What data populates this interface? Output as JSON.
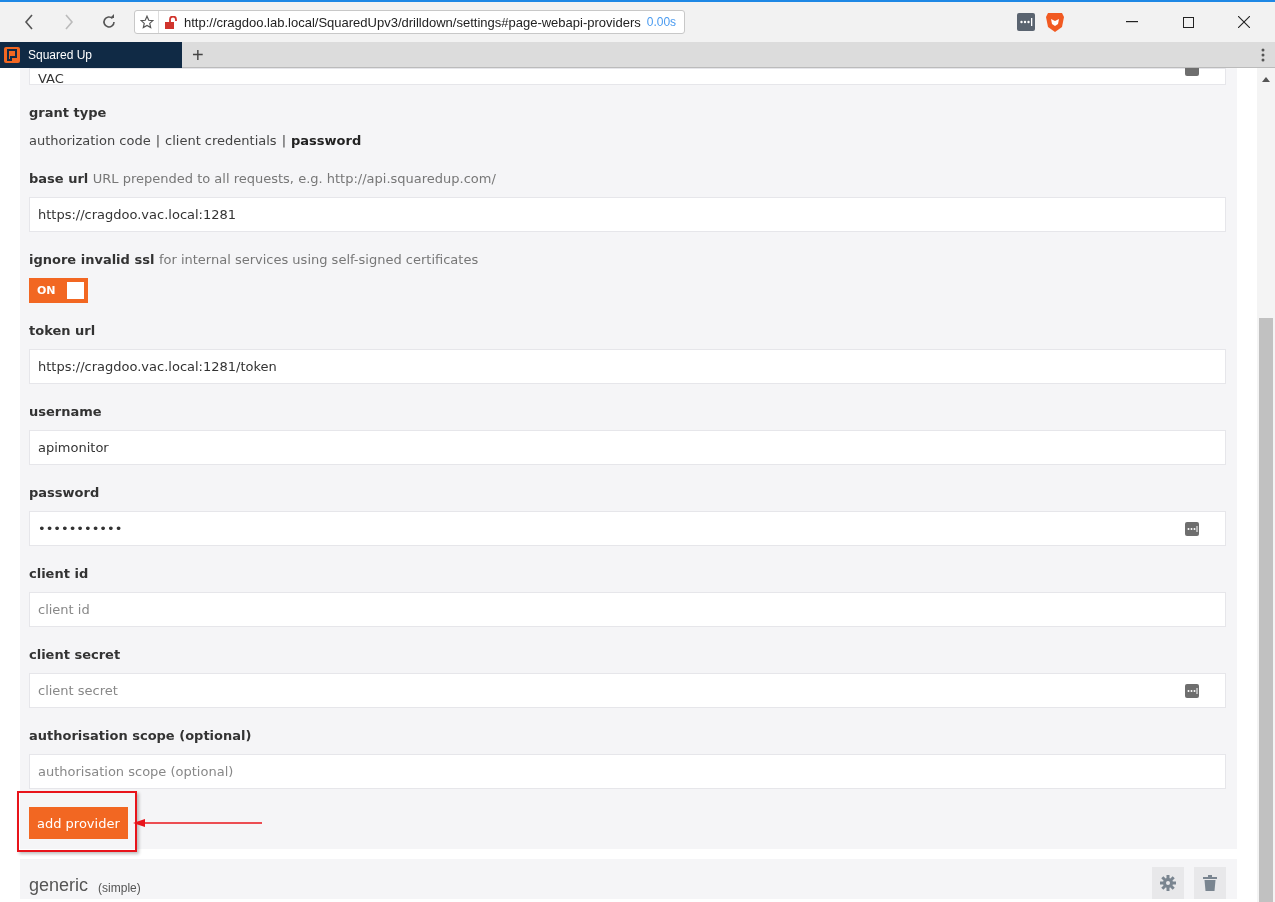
{
  "browser": {
    "url": "http://cragdoo.lab.local/SquaredUpv3/drilldown/settings#page-webapi-providers",
    "load_time": "0.00s",
    "tab_title": "Squared Up",
    "new_tab": "+"
  },
  "form": {
    "top_field": {
      "value": "VAC",
      "has_key_icon": true
    },
    "sections": [
      {
        "kind": "options",
        "label": "grant type",
        "separator": "|",
        "options": [
          {
            "label": "authorization code",
            "selected": false
          },
          {
            "label": "client credentials",
            "selected": false
          },
          {
            "label": "password",
            "selected": true
          }
        ]
      },
      {
        "kind": "text",
        "label": "base url",
        "hint": "URL prepended to all requests, e.g. http://api.squaredup.com/",
        "value": "https://cragdoo.vac.local:1281",
        "has_key_icon": false
      },
      {
        "kind": "toggle",
        "label": "ignore invalid ssl",
        "hint": "for internal services using self-signed certificates",
        "on": true,
        "state_label": "ON"
      },
      {
        "kind": "text",
        "label": "token url",
        "value": "https://cragdoo.vac.local:1281/token",
        "has_key_icon": false
      },
      {
        "kind": "text",
        "label": "username",
        "value": "apimonitor",
        "has_key_icon": false
      },
      {
        "kind": "text",
        "label": "password",
        "value": "•••••••••••",
        "has_key_icon": true
      },
      {
        "kind": "text",
        "label": "client id",
        "placeholder": "client id",
        "has_key_icon": false
      },
      {
        "kind": "text",
        "label": "client secret",
        "placeholder": "client secret",
        "has_key_icon": true
      },
      {
        "kind": "text",
        "label": "authorisation scope (optional)",
        "placeholder": "authorisation scope (optional)",
        "has_key_icon": false
      }
    ],
    "submit": "add provider"
  },
  "next_provider": {
    "name": "generic",
    "type": "(simple)"
  }
}
